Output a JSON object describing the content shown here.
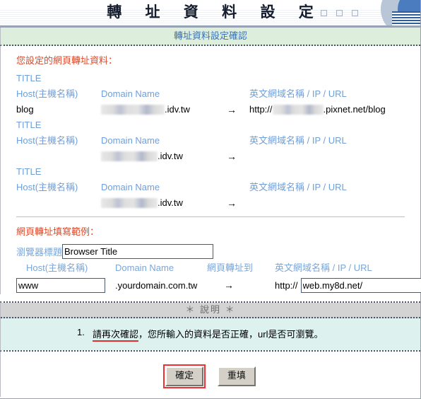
{
  "banner": {
    "title": "轉 址 資 料 設 定",
    "window_boxes": [
      "minimize-box",
      "restore-box",
      "close-box"
    ]
  },
  "subtitle": "轉址資料設定確認",
  "data_section": {
    "heading": "您設定的網頁轉址資料：",
    "title_label": "TITLE",
    "columns": {
      "host": "Host(主機名稱)",
      "domain": "Domain Name",
      "url": "英文網域名稱 / IP / URL"
    },
    "arrow": "→",
    "rows": [
      {
        "title": "TITLE",
        "host": "blog",
        "domain_redacted": true,
        "domain_suffix": ".idv.tw",
        "url_prefix": "http://",
        "url_redacted": true,
        "url_suffix": ".pixnet.net/blog"
      },
      {
        "title": "TITLE",
        "host": "",
        "domain_redacted": true,
        "domain_suffix": ".idv.tw",
        "url_prefix": "",
        "url_redacted": false,
        "url_suffix": ""
      },
      {
        "title": "TITLE",
        "host": "",
        "domain_redacted": true,
        "domain_suffix": ".idv.tw",
        "url_prefix": "",
        "url_redacted": false,
        "url_suffix": ""
      }
    ]
  },
  "example_section": {
    "heading": "網頁轉址填寫範例：",
    "browser_title_label": "瀏覽器標題",
    "browser_title_value": "Browser Title",
    "browser_title_placeholder": "",
    "columns": {
      "host": "Host(主機名稱)",
      "domain": "Domain Name",
      "redirect": "網頁轉址到",
      "url": "英文網域名稱 / IP / URL"
    },
    "host_value": "www",
    "host_placeholder": "",
    "domain_text": ".yourdomain.com.tw",
    "arrow": "→",
    "protocol": "http://",
    "url_value": "web.my8d.net/",
    "url_placeholder": ""
  },
  "explanation": {
    "header": "＊ 說明 ＊",
    "items": [
      {
        "number": "1.",
        "emphasis": "請再次確認",
        "rest": "，您所輸入的資料是否正確，url是否可瀏覽。"
      }
    ]
  },
  "buttons": {
    "confirm": "確定",
    "reset": "重填"
  },
  "colors": {
    "heading_red": "#d94a2a",
    "label_blue": "#6f9fd8",
    "subtitle_blue": "#3b72b8",
    "subtitle_band": "#ddeedd",
    "explain_header_bg": "#d3d3d3",
    "explain_body_bg": "#ddf2ef",
    "focus_red": "#f03030",
    "button_face": "#d4d0c8"
  }
}
